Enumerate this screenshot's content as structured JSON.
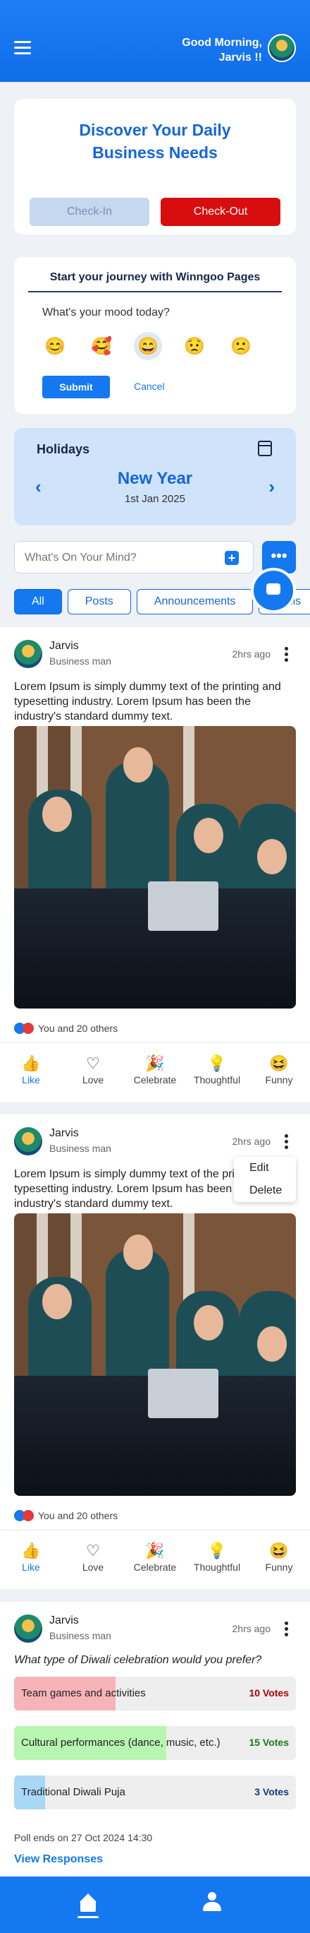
{
  "header": {
    "greeting_line1": "Good Morning,",
    "greeting_line2": "Jarvis !!"
  },
  "discover": {
    "title_line1": "Discover Your Daily",
    "title_line2": "Business Needs",
    "checkin_label": "Check-In",
    "checkout_label": "Check-Out"
  },
  "mood": {
    "title": "Start your journey with Winngoo Pages",
    "question": "What's your mood today?",
    "emojis": [
      "😊",
      "🥰",
      "😄",
      "😟",
      "🙁"
    ],
    "submit_label": "Submit",
    "cancel_label": "Cancel"
  },
  "holidays": {
    "label": "Holidays",
    "name": "New Year",
    "date": "1st Jan 2025"
  },
  "composer": {
    "placeholder": "What's On Your Mind?",
    "plus": "+",
    "more": "•••"
  },
  "filters": [
    "All",
    "Posts",
    "Announcements",
    "Polls"
  ],
  "posts": [
    {
      "name": "Jarvis",
      "role": "Business man",
      "time": "2hrs ago",
      "text": "Lorem Ipsum is simply dummy text of the printing and typesetting industry. Lorem Ipsum has been the industry's standard dummy text.",
      "reactions": "You and 20 others"
    },
    {
      "name": "Jarvis",
      "role": "Business man",
      "time": "2hrs ago",
      "text": "Lorem Ipsum is simply dummy text of the printing and typesetting industry. Lorem Ipsum has been the industry's standard dummy text.",
      "reactions": "You and 20 others",
      "menu": [
        "Edit",
        "Delete"
      ]
    }
  ],
  "actions": [
    "Like",
    "Love",
    "Celebrate",
    "Thoughtful",
    "Funny"
  ],
  "poll": {
    "name": "Jarvis",
    "role": "Business man",
    "time": "2hrs ago",
    "question": "What type of Diwali celebration would you prefer?",
    "options": [
      {
        "label": "Team games and activities",
        "votes": "10 Votes",
        "share": 0.36,
        "color": "#f7b4b8",
        "vote_color": "#b00000"
      },
      {
        "label": "Cultural performances (dance, music, etc.)",
        "votes": "15 Votes",
        "share": 0.54,
        "color": "#b8f5b0",
        "vote_color": "#1a7a1a"
      },
      {
        "label": "Traditional Diwali Puja",
        "votes": "3 Votes",
        "share": 0.11,
        "color": "#a8d8f5",
        "vote_color": "#123a7a"
      }
    ],
    "ends": "Poll ends on 27 Oct 2024 14:30",
    "view_responses": "View Responses"
  }
}
